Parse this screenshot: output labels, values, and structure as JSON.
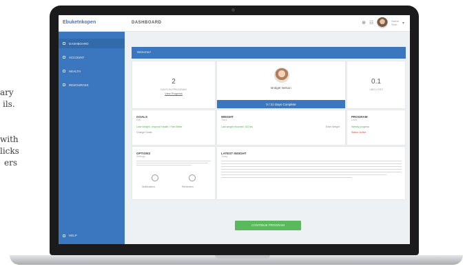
{
  "side_text": [
    "ary",
    "ils.",
    "with",
    "licks",
    "ers"
  ],
  "app": {
    "logo_part1": "E",
    "logo_part2": "buketnkopen",
    "page_title": "DASHBOARD",
    "top_icons": [
      "⊕",
      "☷"
    ],
    "user_line1": "Name",
    "user_line2": "Role"
  },
  "sidebar": {
    "items": [
      {
        "label": "DASHBOARD"
      },
      {
        "label": "ACCOUNT"
      },
      {
        "label": "HEALTH"
      },
      {
        "label": "RESOURCES"
      }
    ],
    "help_label": "HELP"
  },
  "banner": {
    "label": "Welcome!"
  },
  "stats": {
    "left_value": "2",
    "left_label": "DAYS IN PROGRAM",
    "left_sub": "View Progress",
    "right_value": "0.1",
    "right_label": "LBS LOST"
  },
  "profile": {
    "name": "Bridget Nelson",
    "bar_text": "0 / 21  Days Complete"
  },
  "cards": {
    "goals": {
      "title": "GOALS",
      "sub": "Edit",
      "line": "Lose Weight  •  Improve Health  •  Feel Better",
      "link": "Change Goals"
    },
    "weigh": {
      "title": "WEIGHT",
      "sub": "Track",
      "line": "Last weight recorded: 152 lbs",
      "right": "Enter Weight"
    },
    "program": {
      "title": "PROGRAM",
      "sub": "Level",
      "line1": "Weekly progress",
      "line2": "Status: Active"
    },
    "options": {
      "title": "OPTIONS",
      "sub": "Settings",
      "caption_left": "Notifications",
      "caption_right": "Reminders"
    },
    "latest": {
      "title": "LATEST INSIGHT",
      "sub": "Today"
    }
  },
  "cta": {
    "label": "CONTINUE PROGRAM"
  }
}
